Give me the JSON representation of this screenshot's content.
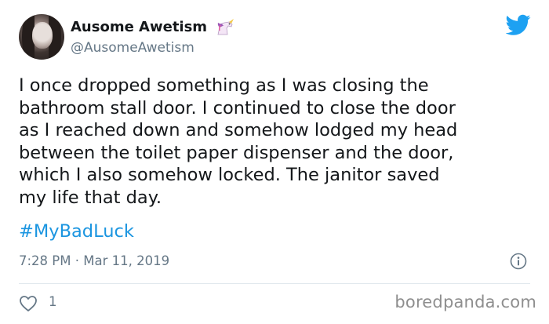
{
  "author": {
    "display_name": "Ausome Awetism",
    "handle": "@AusomeAwetism",
    "badge_icon": "unicorn-icon"
  },
  "tweet": {
    "text": "I once dropped something as I was closing the\nbathroom stall door. I continued to close the door\nas I reached down and somehow lodged my head\nbetween the toilet paper dispenser and the door,\nwhich I also somehow locked. The janitor saved\nmy life that day.",
    "hashtag": "#MyBadLuck",
    "timestamp": "7:28 PM · Mar 11, 2019",
    "likes": "1"
  },
  "icons": {
    "brand": "twitter-bird-icon",
    "info": "info-icon",
    "like": "heart-icon"
  },
  "colors": {
    "link": "#1b95e0",
    "twitter_blue": "#1da1f2",
    "muted_text": "#657786"
  },
  "watermark": "boredpanda.com"
}
